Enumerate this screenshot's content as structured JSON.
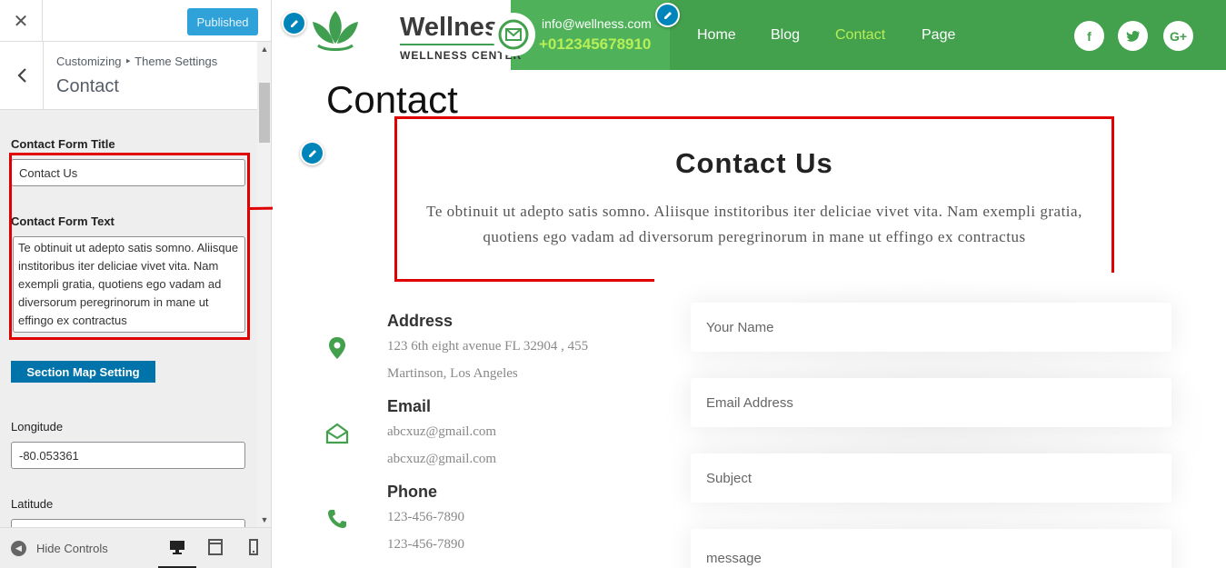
{
  "sidebar": {
    "publish_label": "Published",
    "breadcrumb": "Customizing ‣ Theme Settings",
    "section_title": "Contact",
    "form_title_label": "Contact Form Title",
    "form_title_value": "Contact Us",
    "form_text_label": "Contact Form Text",
    "form_text_value": "Te obtinuit ut adepto satis somno. Aliisque institoribus iter deliciae vivet vita. Nam exempli gratia, quotiens ego vadam ad diversorum peregrinorum in mane ut effingo ex contractus",
    "map_button": "Section Map Setting",
    "longitude_label": "Longitude",
    "longitude_value": "-80.053361",
    "latitude_label": "Latitude",
    "hide_controls": "Hide Controls",
    "active_device": "desktop"
  },
  "header": {
    "logo_name": "Wellness",
    "logo_sub": "WELLNESS CENTER",
    "email": "info@wellness.com",
    "phone": "+012345678910",
    "nav": [
      "Home",
      "Blog",
      "Contact",
      "Page"
    ],
    "active_nav": "Contact",
    "social": [
      "facebook-icon",
      "twitter-icon",
      "google-plus-icon"
    ],
    "green": "#43a04d",
    "accent": "#b6ef57"
  },
  "content": {
    "page_title": "Contact",
    "section_title": "Contact Us",
    "section_text": "Te obtinuit ut adepto satis somno. Aliisque institoribus iter deliciae vivet vita. Nam exempli gratia, quotiens ego vadam ad diversorum peregrinorum in mane ut effingo ex contractus",
    "address_title": "Address",
    "address_line1": "123 6th eight avenue FL 32904 , 455",
    "address_line2": "Martinson, Los Angeles",
    "email_title": "Email",
    "email_line1": "abcxuz@gmail.com",
    "email_line2": "abcxuz@gmail.com",
    "phone_title": "Phone",
    "phone_line1": "123-456-7890",
    "phone_line2": "123-456-7890"
  },
  "form": {
    "name_placeholder": "Your Name",
    "email_placeholder": "Email Address",
    "subject_placeholder": "Subject",
    "message_placeholder": "message"
  }
}
